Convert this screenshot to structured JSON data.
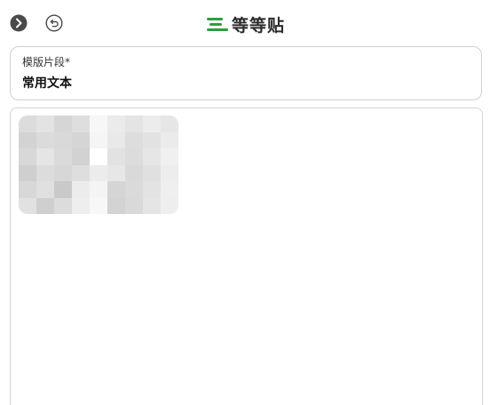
{
  "header": {
    "brand_name": "等等贴",
    "brand_color": "#2e9e3e",
    "forward_icon": "chevron-right-circle-icon",
    "undo_icon": "undo-circle-icon"
  },
  "template_field": {
    "label": "模版片段*",
    "value": "常用文本"
  },
  "editor": {
    "content_image": "blurred-image"
  }
}
